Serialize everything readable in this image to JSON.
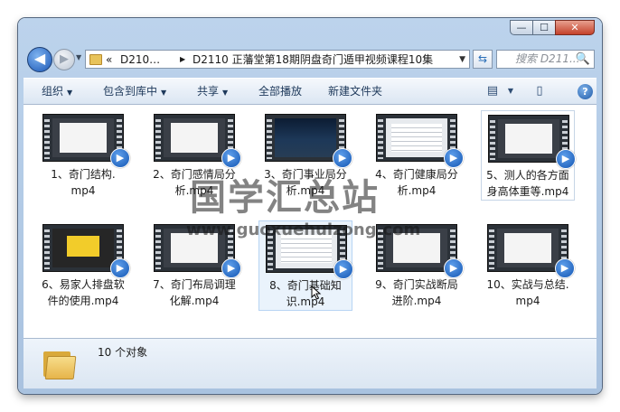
{
  "window": {
    "buttons": {
      "minimize": "—",
      "maximize": "☐",
      "close": "✕"
    }
  },
  "nav": {
    "back_icon": "◀",
    "forward_icon": "▶",
    "recent_icon": "▼",
    "address_prefix": "«",
    "address_parent": "D210…",
    "address_sep": "▶",
    "address_current": "D2110 正藩堂第18期阴盘奇门遁甲视频课程10集",
    "address_dropdown": "▼",
    "refresh_icon": "⇆",
    "search_placeholder": "搜索 D211...",
    "search_icon": "🔍"
  },
  "toolbar": {
    "organize": "组织",
    "include": "包含到库中",
    "share": "共享",
    "play_all": "全部播放",
    "new_folder": "新建文件夹",
    "arrow": "▼",
    "view_icon": "▤",
    "pane_icon": "▯",
    "help": "?"
  },
  "files": [
    {
      "name": "1、奇门结构.mp4",
      "line1": "1、奇门结构.",
      "line2": "mp4",
      "thumb": "pres"
    },
    {
      "name": "2、奇门感情局分析.mp4",
      "line1": "2、奇门感情局分",
      "line2": "析.mp4",
      "thumb": "pres"
    },
    {
      "name": "3、奇门事业局分析.mp4",
      "line1": "3、奇门事业局分",
      "line2": "析.mp4",
      "thumb": "dark"
    },
    {
      "name": "4、奇门健康局分析.mp4",
      "line1": "4、奇门健康局分",
      "line2": "析.mp4",
      "thumb": "table"
    },
    {
      "name": "5、测人的各方面身高体重等.mp4",
      "line1": "5、测人的各方面",
      "line2": "身高体重等.mp4",
      "thumb": "pres"
    },
    {
      "name": "6、易家人排盘软件的使用.mp4",
      "line1": "6、易家人排盘软",
      "line2": "件的使用.mp4",
      "thumb": "yellow"
    },
    {
      "name": "7、奇门布局调理化解.mp4",
      "line1": "7、奇门布局调理",
      "line2": "化解.mp4",
      "thumb": "pres"
    },
    {
      "name": "8、奇门基础知识.mp4",
      "line1": "8、奇门基础知",
      "line2": "识.mp4",
      "thumb": "table"
    },
    {
      "name": "9、奇门实战断局进阶.mp4",
      "line1": "9、奇门实战断局",
      "line2": "进阶.mp4",
      "thumb": "pres"
    },
    {
      "name": "10、实战与总结.mp4",
      "line1": "10、实战与总结.",
      "line2": "mp4",
      "thumb": "pres"
    }
  ],
  "details": {
    "count": "10 个对象"
  },
  "watermark": {
    "text": "国学汇总站",
    "url": "www.guoxuehuizong.com"
  }
}
